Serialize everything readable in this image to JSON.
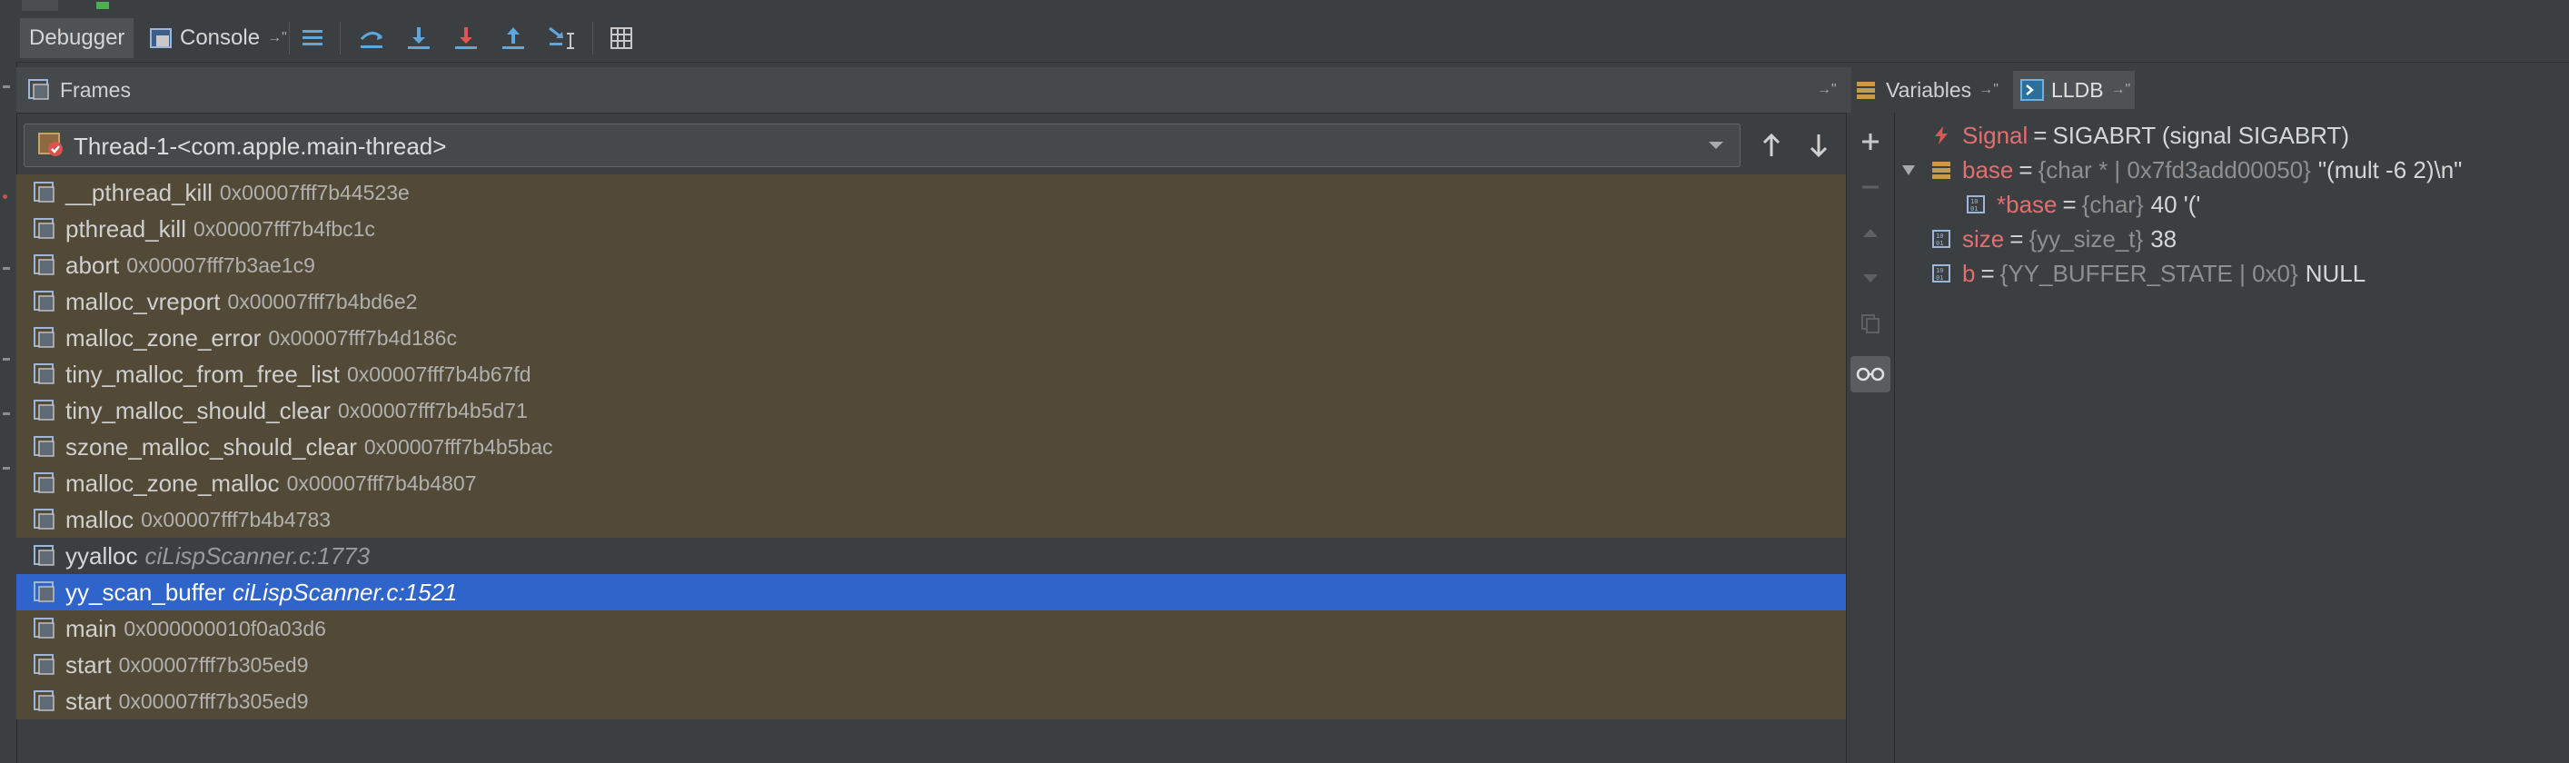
{
  "toolbar": {
    "tabs": {
      "debugger": "Debugger",
      "console": "Console"
    },
    "pin_glyph": "→\""
  },
  "frames_panel": {
    "title": "Frames",
    "thread": "Thread-1-<com.apple.main-thread>",
    "frames": [
      {
        "name": "__pthread_kill",
        "detail": "0x00007fff7b44523e",
        "kind": "lib"
      },
      {
        "name": "pthread_kill",
        "detail": "0x00007fff7b4fbc1c",
        "kind": "lib"
      },
      {
        "name": "abort",
        "detail": "0x00007fff7b3ae1c9",
        "kind": "lib"
      },
      {
        "name": "malloc_vreport",
        "detail": "0x00007fff7b4bd6e2",
        "kind": "lib"
      },
      {
        "name": "malloc_zone_error",
        "detail": "0x00007fff7b4d186c",
        "kind": "lib"
      },
      {
        "name": "tiny_malloc_from_free_list",
        "detail": "0x00007fff7b4b67fd",
        "kind": "lib"
      },
      {
        "name": "tiny_malloc_should_clear",
        "detail": "0x00007fff7b4b5d71",
        "kind": "lib"
      },
      {
        "name": "szone_malloc_should_clear",
        "detail": "0x00007fff7b4b5bac",
        "kind": "lib"
      },
      {
        "name": "malloc_zone_malloc",
        "detail": "0x00007fff7b4b4807",
        "kind": "lib"
      },
      {
        "name": "malloc",
        "detail": "0x00007fff7b4b4783",
        "kind": "lib"
      },
      {
        "name": "yyalloc",
        "detail": "ciLispScanner.c:1773",
        "kind": "user"
      },
      {
        "name": "yy_scan_buffer",
        "detail": "ciLispScanner.c:1521",
        "kind": "selected"
      },
      {
        "name": "main",
        "detail": "0x000000010f0a03d6",
        "kind": "lib"
      },
      {
        "name": "start",
        "detail": "0x00007fff7b305ed9",
        "kind": "lib"
      },
      {
        "name": "start",
        "detail": "0x00007fff7b305ed9",
        "kind": "lib"
      }
    ]
  },
  "right_tabs": {
    "variables": "Variables",
    "lldb": "LLDB"
  },
  "variables": {
    "signal": {
      "name": "Signal",
      "eq": "=",
      "value": "SIGABRT (signal SIGABRT)"
    },
    "base": {
      "name": "base",
      "eq": "=",
      "type": "{char * | 0x7fd3add00050}",
      "value": "\"(mult -6 2)\\n\""
    },
    "base_deref": {
      "name": "*base",
      "eq": "=",
      "type": "{char}",
      "value": "40 '('"
    },
    "size": {
      "name": "size",
      "eq": "=",
      "type": "{yy_size_t}",
      "value": "38"
    },
    "b": {
      "name": "b",
      "eq": "=",
      "type": "{YY_BUFFER_STATE | 0x0}",
      "value": "NULL"
    }
  },
  "colors": {
    "lib_row": "#524a37",
    "selected_row": "#2f65ca",
    "var_name": "#e26f6f"
  }
}
